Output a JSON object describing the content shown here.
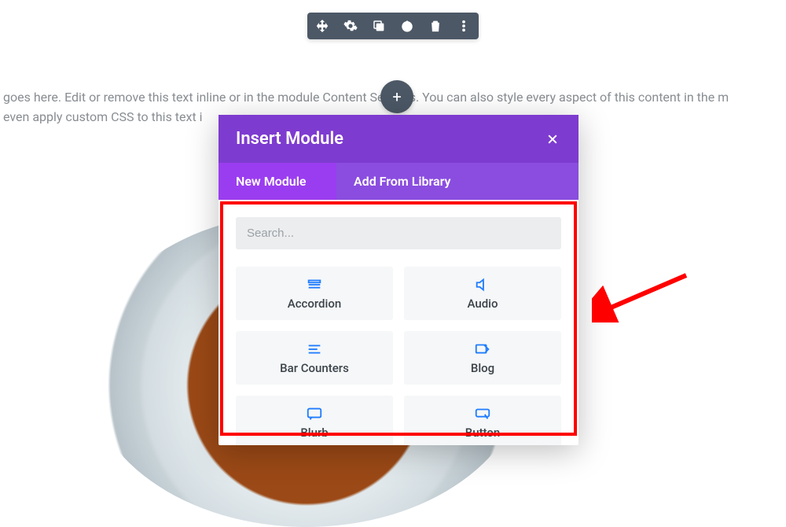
{
  "toolbar": {
    "icons": [
      "move-icon",
      "gear-icon",
      "duplicate-icon",
      "power-icon",
      "trash-icon",
      "more-icon"
    ]
  },
  "bg_text": {
    "line1": "goes here. Edit or remove this text inline or in the module Content Settings. You can also style every aspect of this content in the m",
    "line2": "even apply custom CSS to this text i"
  },
  "add_button": {
    "symbol": "+"
  },
  "modal": {
    "title": "Insert Module",
    "tabs": {
      "new": "New Module",
      "lib": "Add From Library"
    },
    "search_placeholder": "Search...",
    "modules": [
      {
        "name": "Accordion"
      },
      {
        "name": "Audio"
      },
      {
        "name": "Bar Counters"
      },
      {
        "name": "Blog"
      },
      {
        "name": "Blurb"
      },
      {
        "name": "Button"
      }
    ]
  }
}
